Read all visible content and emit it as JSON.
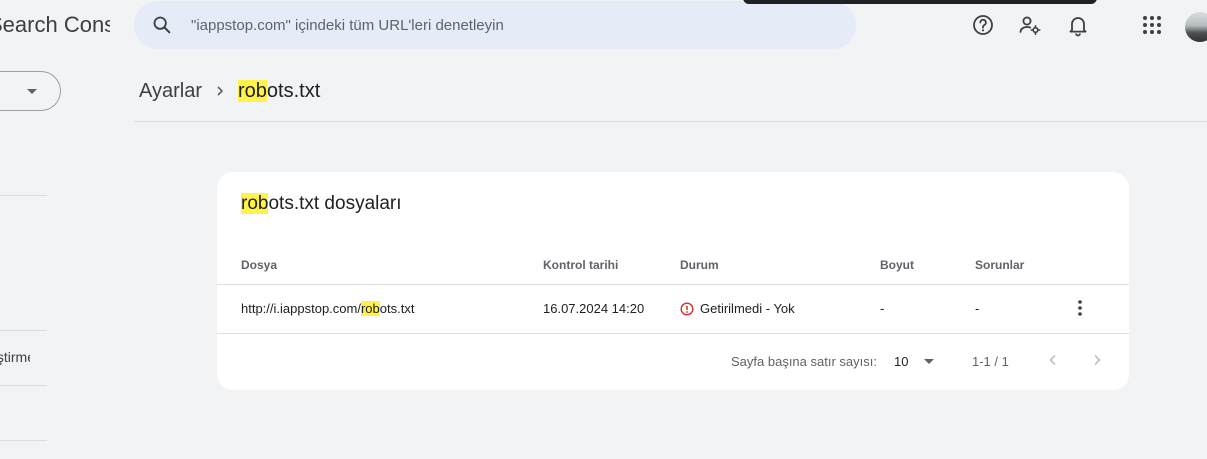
{
  "app": {
    "title": "Search Console"
  },
  "sidebar": {
    "partial_item": "Geliştirmeler"
  },
  "search": {
    "placeholder": "\"iappstop.com\" içindeki tüm URL'leri denetleyin"
  },
  "header": {
    "icons": [
      "help-icon",
      "manage-users-icon",
      "notifications-icon",
      "apps-grid-icon",
      "avatar"
    ]
  },
  "breadcrumb": {
    "parent": "Ayarlar",
    "current_highlight": "rob",
    "current_rest": "ots.txt"
  },
  "card": {
    "title_highlight": "rob",
    "title_rest": "ots.txt dosyaları",
    "columns": [
      "Dosya",
      "Kontrol tarihi",
      "Durum",
      "Boyut",
      "Sorunlar"
    ],
    "rows": [
      {
        "file_prefix": "http://i.iappstop.com/",
        "file_highlight": "rob",
        "file_suffix": "ots.txt",
        "checked": "16.07.2024 14:20",
        "status": "Getirilmedi - Yok",
        "size": "-",
        "issues": "-"
      }
    ],
    "pagination": {
      "rows_per_page_label": "Sayfa başına satır sayısı:",
      "rows_per_page": "10",
      "range": "1-1 / 1"
    }
  },
  "colors": {
    "highlight": "#fff24a",
    "error": "#d93025",
    "search_bg": "#e6ecf7",
    "page_bg": "#f1f3f4"
  }
}
